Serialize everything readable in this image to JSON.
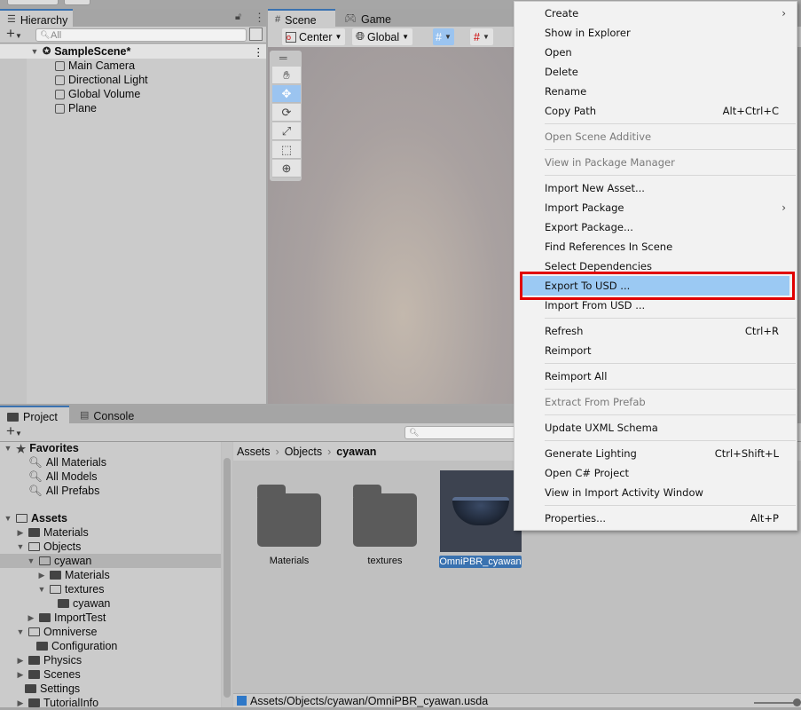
{
  "hierarchy": {
    "tab_label": "Hierarchy",
    "search_placeholder": "All",
    "scene": "SampleScene*",
    "objects": [
      "Main Camera",
      "Directional Light",
      "Global Volume",
      "Plane"
    ]
  },
  "scene_view": {
    "tabs": [
      "Scene",
      "Game"
    ],
    "pivot": "Center",
    "space": "Global",
    "tools": [
      "hand",
      "move",
      "rotate",
      "scale",
      "rect",
      "transform"
    ],
    "active_tool": "move"
  },
  "project": {
    "tabs": [
      "Project",
      "Console"
    ],
    "favorites_label": "Favorites",
    "favorites": [
      "All Materials",
      "All Models",
      "All Prefabs"
    ],
    "tree": [
      {
        "label": "Assets",
        "depth": 0
      },
      {
        "label": "Materials",
        "depth": 1
      },
      {
        "label": "Objects",
        "depth": 1
      },
      {
        "label": "cyawan",
        "depth": 2,
        "selected": true
      },
      {
        "label": "Materials",
        "depth": 3
      },
      {
        "label": "textures",
        "depth": 3
      },
      {
        "label": "cyawan",
        "depth": 4
      },
      {
        "label": "ImportTest",
        "depth": 2
      },
      {
        "label": "Omniverse",
        "depth": 1
      },
      {
        "label": "Configuration",
        "depth": 2
      },
      {
        "label": "Physics",
        "depth": 1
      },
      {
        "label": "Scenes",
        "depth": 1
      },
      {
        "label": "Settings",
        "depth": 1
      },
      {
        "label": "TutorialInfo",
        "depth": 1
      }
    ],
    "breadcrumb": [
      "Assets",
      "Objects",
      "cyawan"
    ],
    "items": [
      "Materials",
      "textures",
      "OmniPBR_cyawan"
    ],
    "selected_item": "OmniPBR_cyawan",
    "status_path": "Assets/Objects/cyawan/OmniPBR_cyawan.usda"
  },
  "context_menu": {
    "groups": [
      [
        {
          "label": "Create",
          "submenu": true
        },
        {
          "label": "Show in Explorer"
        },
        {
          "label": "Open"
        },
        {
          "label": "Delete"
        },
        {
          "label": "Rename"
        },
        {
          "label": "Copy Path",
          "shortcut": "Alt+Ctrl+C"
        }
      ],
      [
        {
          "label": "Open Scene Additive",
          "disabled": true
        }
      ],
      [
        {
          "label": "View in Package Manager",
          "disabled": true
        }
      ],
      [
        {
          "label": "Import New Asset..."
        },
        {
          "label": "Import Package",
          "submenu": true
        },
        {
          "label": "Export Package..."
        },
        {
          "label": "Find References In Scene"
        },
        {
          "label": "Select Dependencies"
        },
        {
          "label": "Export To USD ...",
          "highlighted": true
        },
        {
          "label": "Import From USD ..."
        }
      ],
      [
        {
          "label": "Refresh",
          "shortcut": "Ctrl+R"
        },
        {
          "label": "Reimport"
        }
      ],
      [
        {
          "label": "Reimport All"
        }
      ],
      [
        {
          "label": "Extract From Prefab",
          "disabled": true
        }
      ],
      [
        {
          "label": "Update UXML Schema"
        }
      ],
      [
        {
          "label": "Generate Lighting",
          "shortcut": "Ctrl+Shift+L"
        },
        {
          "label": "Open C# Project"
        },
        {
          "label": "View in Import Activity Window"
        }
      ],
      [
        {
          "label": "Properties...",
          "shortcut": "Alt+P"
        }
      ]
    ]
  },
  "colors": {
    "selection": "#3a72b0",
    "menu_highlight": "#9bc9f3",
    "highlight_box": "#e10000",
    "active_tool": "#9bc4f0"
  }
}
